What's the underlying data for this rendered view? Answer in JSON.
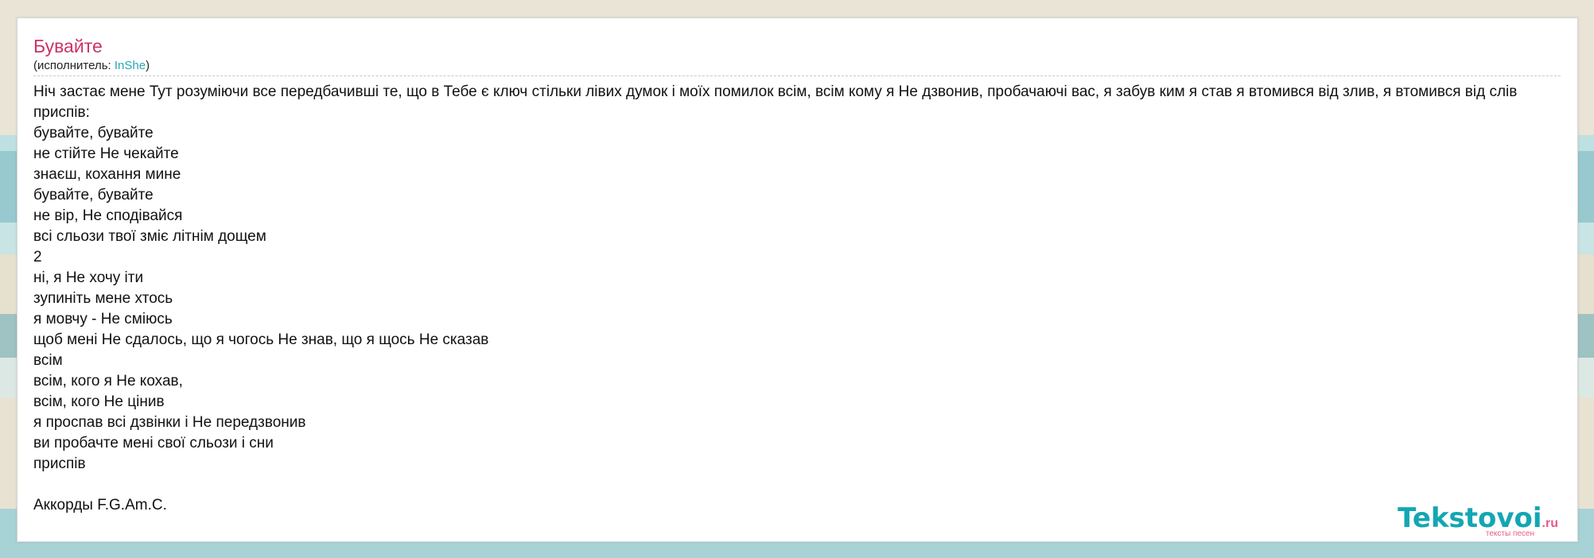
{
  "song": {
    "title": "Бувайте",
    "artist_prefix": "(исполнитель: ",
    "artist": "InShe",
    "artist_suffix": ")"
  },
  "lyrics": [
    "Ніч застає мене Тут розуміючи все передбачивші те, що в Тебе є ключ стільки лівих думок і моїх помилок всім, всім кому я Не дзвонив, пробачаючі вас, я забув ким я став я втомився від злив, я втомився від слів",
    "приспів:",
    "бувайте, бувайте",
    "не стійте Не чекайте",
    "знаєш, кохання мине",
    "бувайте, бувайте",
    "не вір, Не сподівайся",
    "всі сльози твої зміє літнім дощем",
    "2",
    "ні, я Не хочу іти",
    "зупиніть мене хтось",
    "я мовчу - Не сміюсь",
    "щоб мені Не сдалось, що я чогось Не знав, що я щось Не сказав",
    "всім",
    "всім, кого я Не кохав,",
    "всім, кого Не цінив",
    "я проспав всі дзвінки і Не передзвонив",
    "ви пробачте мені свої сльози і сни",
    "приспів",
    "",
    "Аккорды F.G.Am.C."
  ],
  "logo": {
    "name": "Tekstovoi",
    "tld": ".ru",
    "tagline": "тексты песен"
  },
  "colors": {
    "title": "#cc3366",
    "link": "#2aa6b7",
    "logo": "#13a6b4",
    "logo_accent": "#e8588a"
  }
}
